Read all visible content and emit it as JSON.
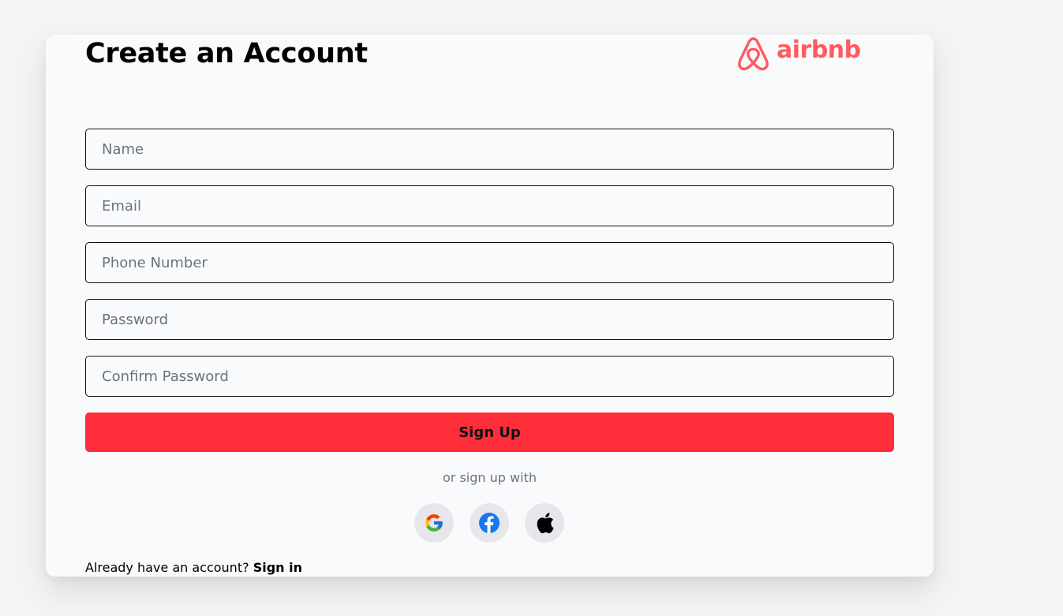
{
  "header": {
    "title": "Create an Account",
    "brand_name": "airbnb",
    "brand_color": "#ff5a5f"
  },
  "form": {
    "fields": [
      {
        "placeholder": "Name",
        "value": ""
      },
      {
        "placeholder": "Email",
        "value": ""
      },
      {
        "placeholder": "Phone Number",
        "value": ""
      },
      {
        "placeholder": "Password",
        "value": ""
      },
      {
        "placeholder": "Confirm Password",
        "value": ""
      }
    ],
    "submit_label": "Sign Up",
    "submit_color": "#ff2d3a"
  },
  "social": {
    "label": "or sign up with",
    "providers": [
      {
        "name": "google",
        "icon": "google-icon"
      },
      {
        "name": "facebook",
        "icon": "facebook-icon"
      },
      {
        "name": "apple",
        "icon": "apple-icon"
      }
    ]
  },
  "footer": {
    "prompt": "Already have an account?",
    "link_label": "Sign in"
  }
}
